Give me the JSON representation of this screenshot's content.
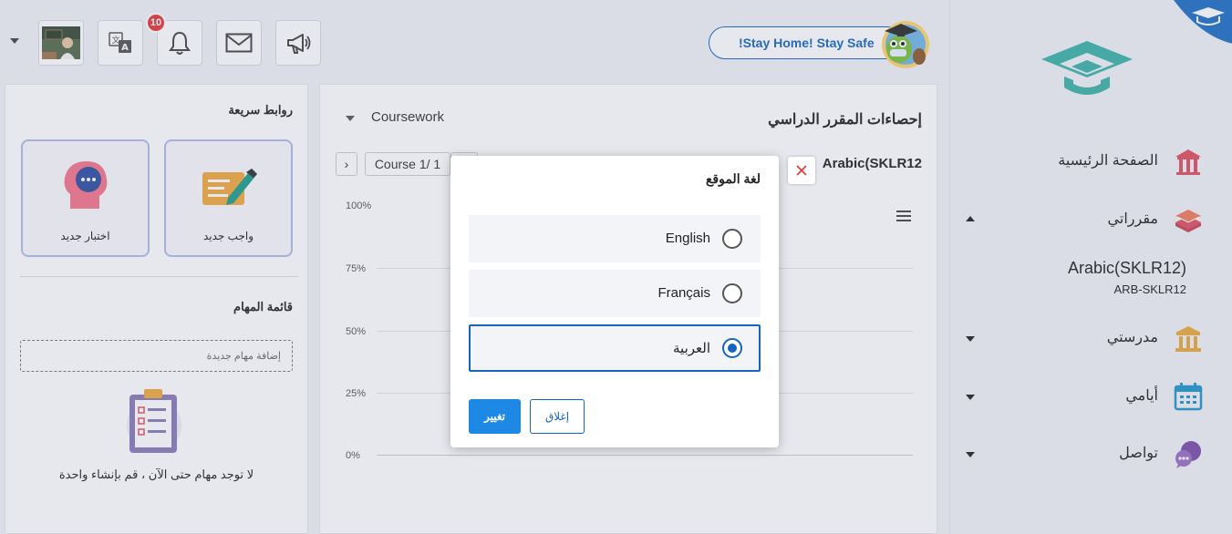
{
  "topbar": {
    "notification_count": "10",
    "stay_home_label": "!Stay Home! Stay Safe",
    "icons": [
      "avatar-photo",
      "translate-icon",
      "bell-icon",
      "mail-icon",
      "megaphone-icon"
    ]
  },
  "sidebar": {
    "items": [
      {
        "label": "الصفحة الرئيسية",
        "icon": "home-icon"
      },
      {
        "label": "مقرراتي",
        "icon": "books-icon"
      },
      {
        "label": "مدرستي",
        "icon": "school-icon"
      },
      {
        "label": "أيامي",
        "icon": "calendar-icon"
      },
      {
        "label": "تواصل",
        "icon": "chat-icon"
      }
    ],
    "course": {
      "name": "Arabic(SKLR12)",
      "code": "ARB-SKLR12"
    }
  },
  "quick_links": {
    "title": "روابط سريعة",
    "cards": [
      {
        "label": "واجب جديد"
      },
      {
        "label": "اختبار جديد"
      }
    ]
  },
  "tasks": {
    "title": "قائمة المهام",
    "placeholder": "إضافة مهام جديدة",
    "empty_text": "لا توجد مهام حتى الآن ، قم بإنشاء واحدة"
  },
  "stats": {
    "title": "إحصاءات المقرر الدراسي",
    "select_value": "Coursework",
    "pager": "Course 1/ 1",
    "course_label": "Arabic(SKLR12",
    "y_ticks": [
      "100%",
      "75%",
      "50%",
      "25%",
      "0%"
    ]
  },
  "modal": {
    "title": "لغة الموقع",
    "options": [
      {
        "label": "English",
        "selected": false
      },
      {
        "label": "Français",
        "selected": false
      },
      {
        "label": "العربية",
        "selected": true
      }
    ],
    "change_button": "تغيير",
    "close_button": "إغلاق"
  }
}
